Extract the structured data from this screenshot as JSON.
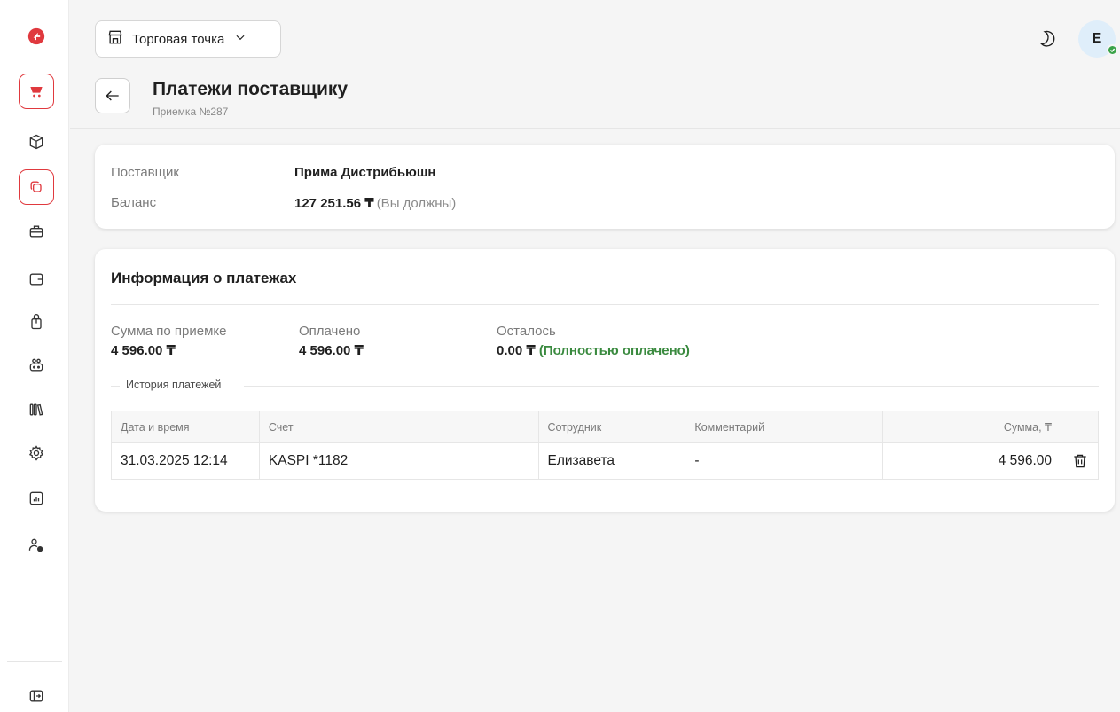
{
  "topbar": {
    "store_label": "Торговая точка",
    "avatar_initial": "Е"
  },
  "header": {
    "title": "Платежи поставщику",
    "subtitle": "Приемка №287"
  },
  "supplier": {
    "supplier_label": "Поставщик",
    "supplier_name": "Прима Дистрибьюшн",
    "balance_label": "Баланс",
    "balance_value": "127 251.56 ₸",
    "balance_note": "(Вы должны)"
  },
  "payments": {
    "title": "Информация о платежах",
    "receipt_sum_label": "Сумма по приемке",
    "receipt_sum_value": "4 596.00 ₸",
    "paid_label": "Оплачено",
    "paid_value": "4 596.00 ₸",
    "remaining_label": "Осталось",
    "remaining_value": "0.00 ₸",
    "remaining_note": "(Полностью оплачено)",
    "history_label": "История платежей",
    "columns": [
      "Дата и время",
      "Счет",
      "Сотрудник",
      "Комментарий",
      "Сумма, ₸"
    ],
    "rows": [
      {
        "datetime": "31.03.2025 12:14",
        "account": "KASPI *1182",
        "employee": "Елизавета",
        "comment": "-",
        "amount": "4 596.00"
      }
    ]
  },
  "colors": {
    "brand_red": "#e0393e",
    "paid_green": "#3a8a3f",
    "avatar_bg": "#dfeefa"
  },
  "icons": {
    "sidebar": [
      "logo-icon",
      "cart-icon",
      "box-icon",
      "layers-icon",
      "briefcase-icon",
      "wallet-icon",
      "bag-icon",
      "robot-icon",
      "library-icon",
      "gear-icon",
      "report-icon",
      "users-settings-icon",
      "collapse-icon"
    ]
  }
}
